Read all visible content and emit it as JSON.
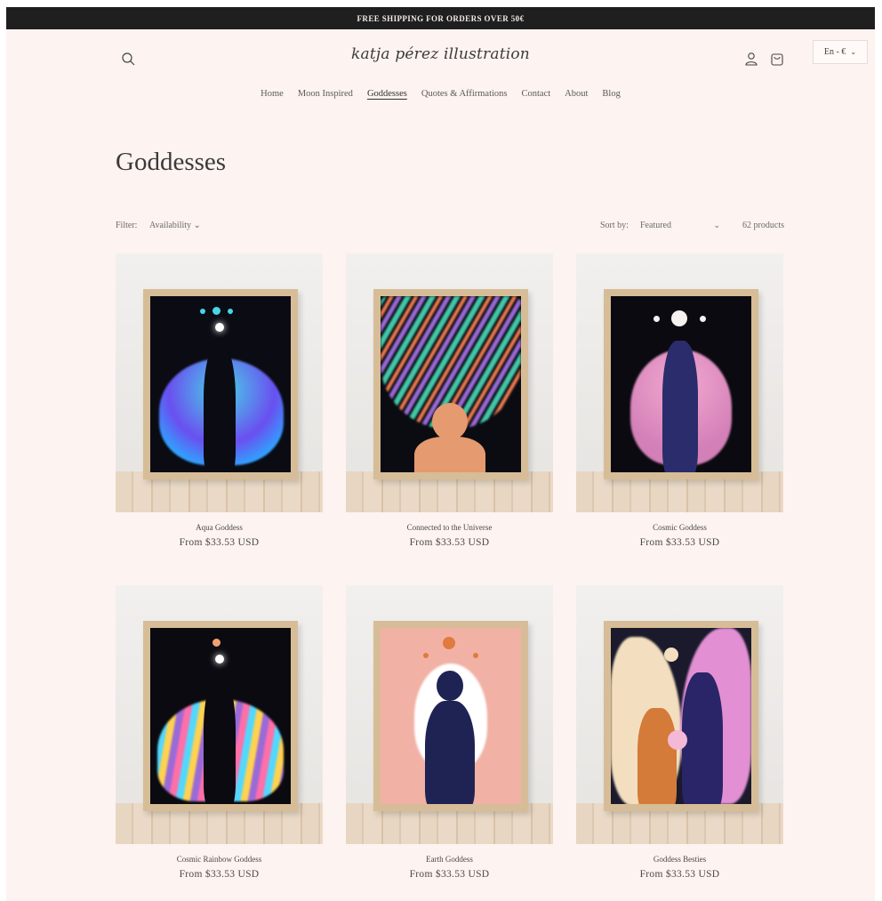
{
  "announcement": "FREE SHIPPING FOR ORDERS OVER 50€",
  "header": {
    "logo": "katja pérez illustration",
    "search_icon": "search-icon",
    "account_icon": "account-icon",
    "cart_icon": "cart-icon",
    "language": "En - €",
    "language_chevron": "⌄"
  },
  "nav": {
    "items": [
      "Home",
      "Moon Inspired",
      "Goddesses",
      "Quotes & Affirmations",
      "Contact",
      "About",
      "Blog"
    ],
    "active": "Goddesses"
  },
  "page": {
    "title": "Goddesses"
  },
  "toolbar": {
    "filter_label": "Filter:",
    "filter_value": "Availability ⌄",
    "sort_label": "Sort by:",
    "sort_value": "Featured",
    "sort_chevron": "⌄",
    "count": "62 products"
  },
  "products": [
    {
      "title": "Aqua Goddess",
      "price": "From $33.53 USD",
      "palette": [
        "#0b0b14",
        "#46d6e6",
        "#6a4ff0",
        "#2fa3ff"
      ]
    },
    {
      "title": "Connected to the Universe",
      "price": "From $33.53 USD",
      "palette": [
        "#0b0c12",
        "#42c7a8",
        "#f07b4f",
        "#9a6ad8"
      ]
    },
    {
      "title": "Cosmic Goddess",
      "price": "From $33.53 USD",
      "palette": [
        "#0a0a10",
        "#f2a9cf",
        "#d37fb8",
        "#2a2c6b"
      ]
    },
    {
      "title": "Cosmic Rainbow Goddess",
      "price": "From $33.53 USD",
      "palette": [
        "#0a0a10",
        "#ff6fa8",
        "#52d8ff",
        "#ffd24f"
      ]
    },
    {
      "title": "Earth Goddess",
      "price": "From $33.53 USD",
      "palette": [
        "#f2b1a5",
        "#ffffff",
        "#1f2354",
        "#e07a3f"
      ]
    },
    {
      "title": "Goddess Besties",
      "price": "From $33.53 USD",
      "palette": [
        "#1a1a2c",
        "#f3dfbf",
        "#e38fd3",
        "#d47b3a"
      ]
    }
  ]
}
